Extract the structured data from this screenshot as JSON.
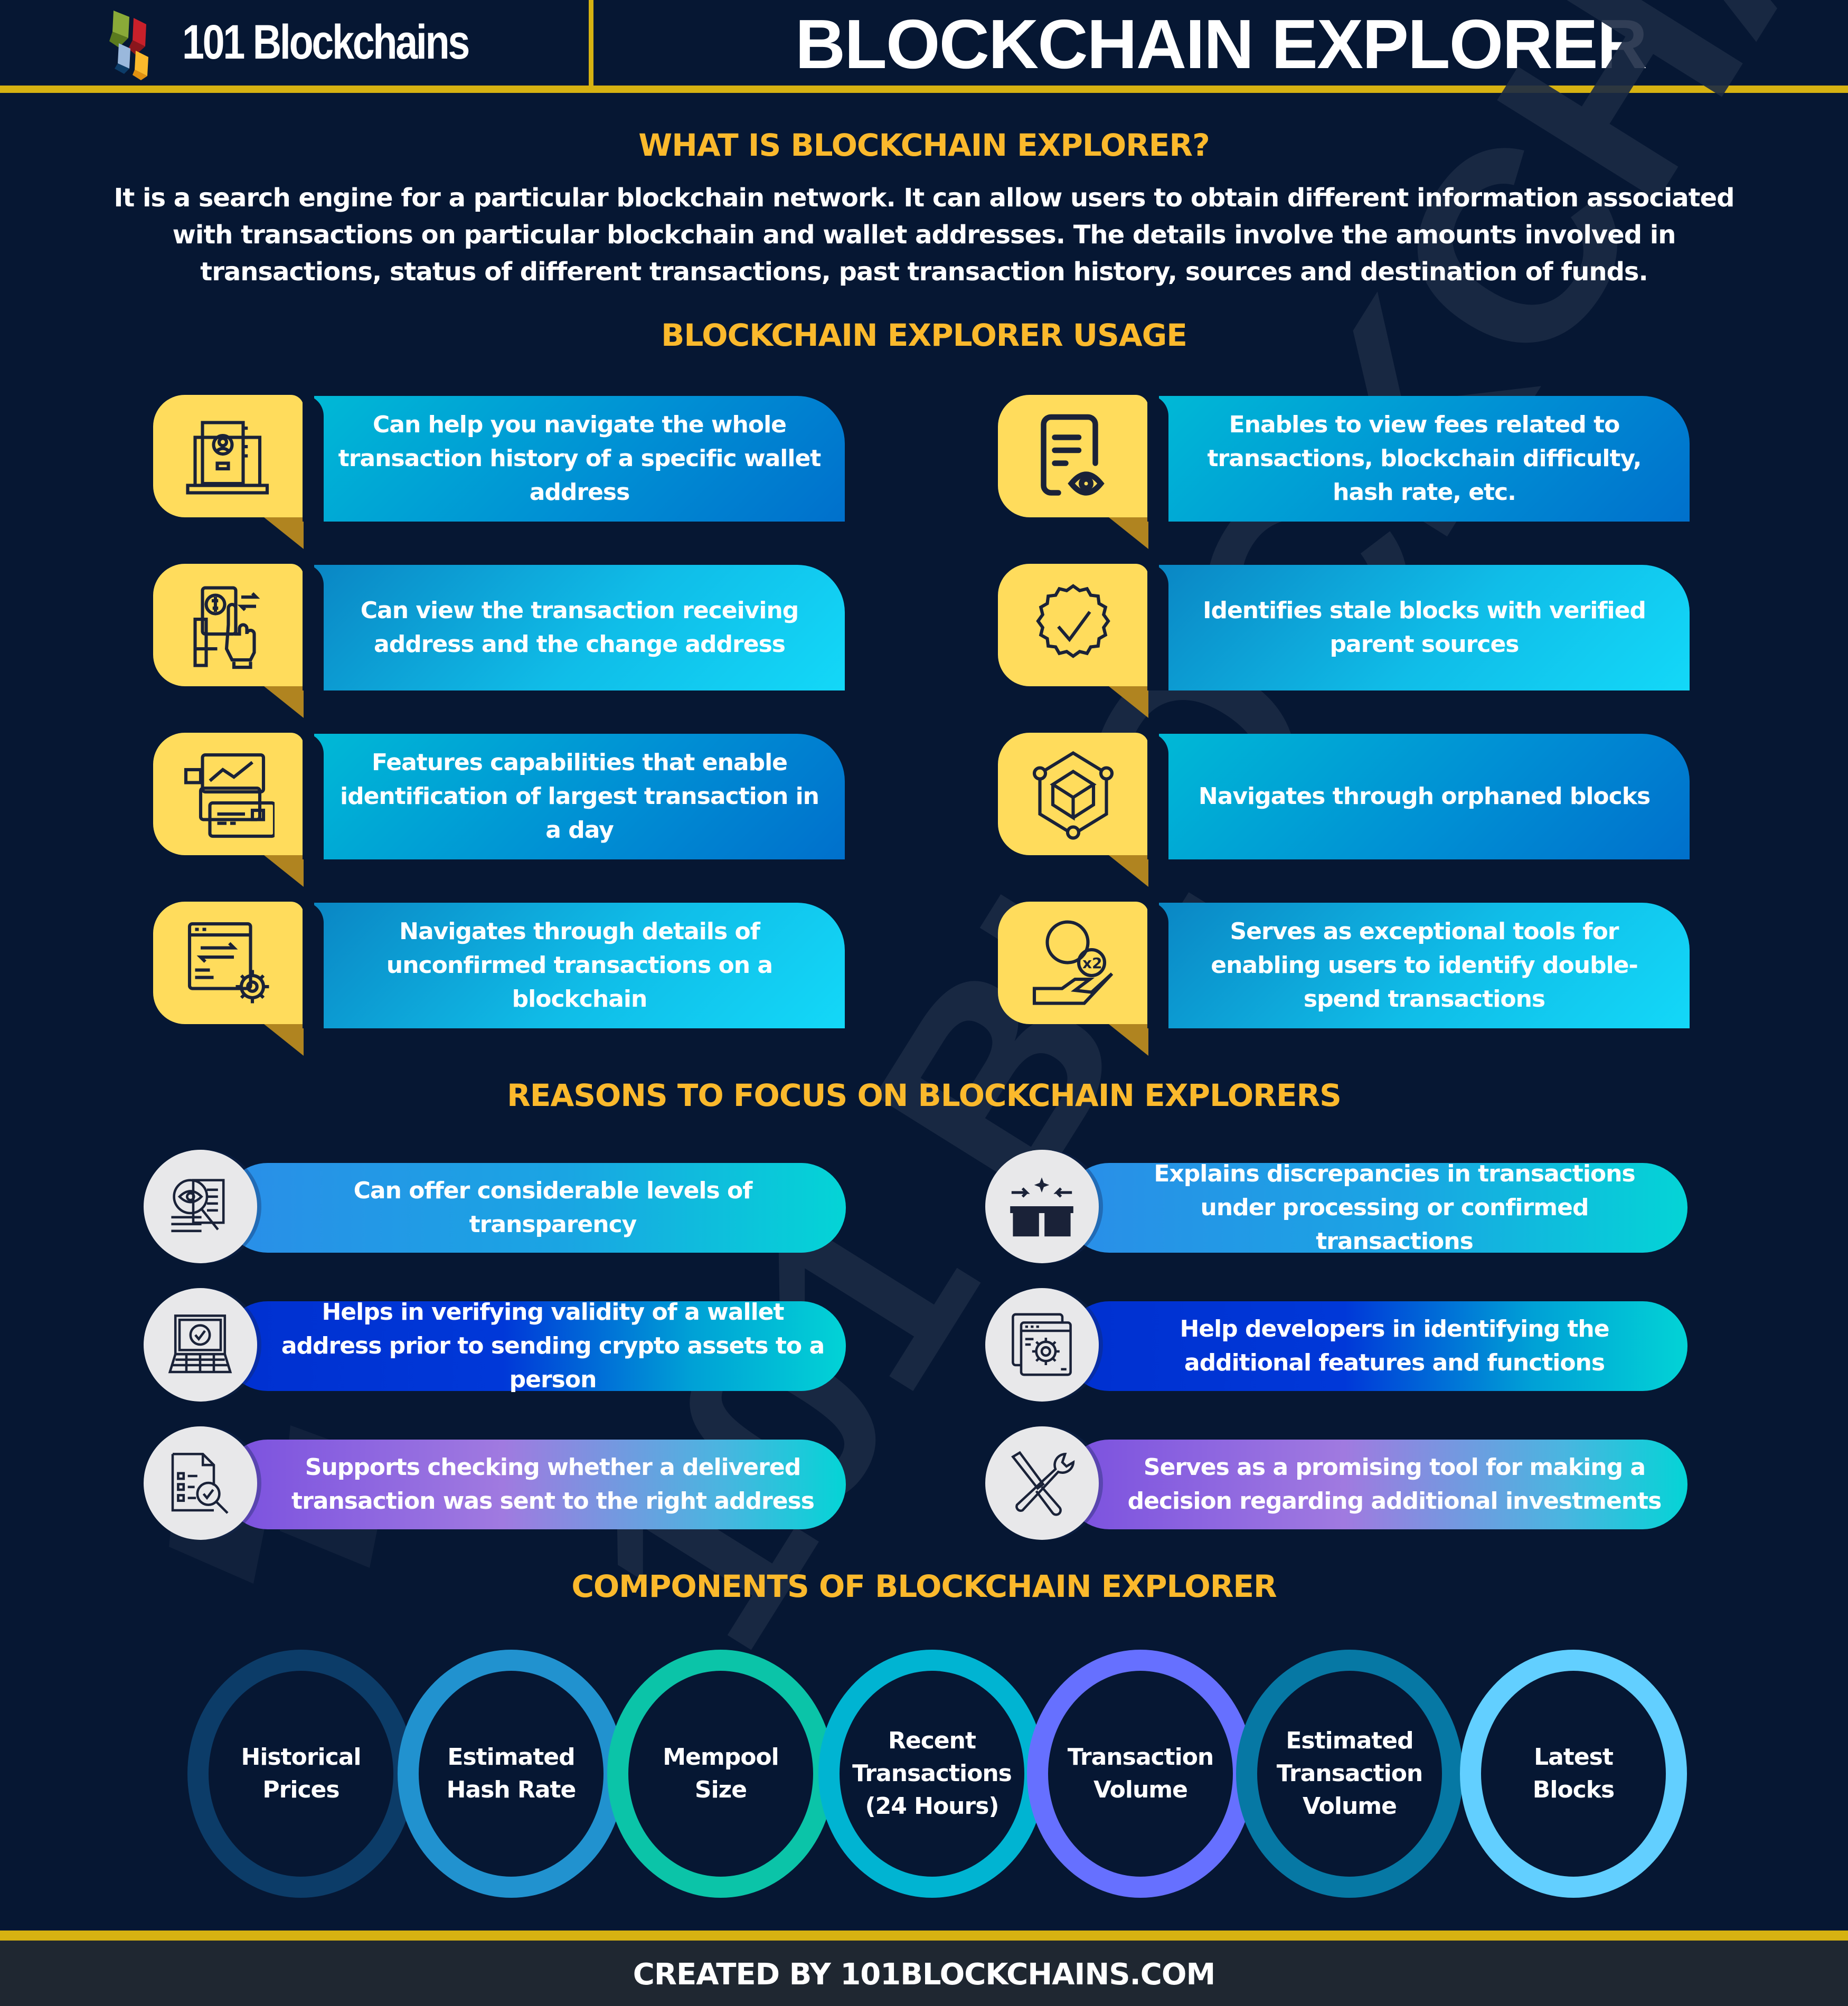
{
  "header": {
    "logo_text": "101 Blockchains",
    "title": "BLOCKCHAIN EXPLORER"
  },
  "intro": {
    "heading": "WHAT IS BLOCKCHAIN EXPLORER?",
    "text": "It is a search engine for a particular blockchain network. It can allow users to obtain different information associated with transactions on particular blockchain and wallet addresses. The details involve the amounts involved in transactions, status of different transactions, past transaction history, sources and destination of funds."
  },
  "usage": {
    "heading": "BLOCKCHAIN EXPLORER USAGE",
    "items": [
      {
        "icon": "laptop-profile-icon",
        "text": "Can help you navigate the whole transaction history of a specific wallet address"
      },
      {
        "icon": "document-eye-icon",
        "text": "Enables to view fees related to transactions, blockchain difficulty, hash rate, etc."
      },
      {
        "icon": "hand-dollar-transfer-icon",
        "text": "Can view the transaction receiving address and the change address"
      },
      {
        "icon": "verified-badge-icon",
        "text": "Identifies stale blocks with verified parent sources"
      },
      {
        "icon": "cards-chart-icon",
        "text": "Features capabilities that enable identification of largest transaction in a day"
      },
      {
        "icon": "block-network-icon",
        "text": "Navigates through orphaned blocks"
      },
      {
        "icon": "screen-gear-transfer-icon",
        "text": "Navigates through details of unconfirmed transactions on a blockchain"
      },
      {
        "icon": "hand-coins-x2-icon",
        "text": "Serves as exceptional tools for enabling users to identify double-spend transactions"
      }
    ]
  },
  "reasons": {
    "heading": "REASONS TO FOCUS ON BLOCKCHAIN EXPLORERS",
    "items": [
      {
        "icon": "magnifier-eye-document-icon",
        "text": "Can offer considerable levels of transparency"
      },
      {
        "icon": "boxes-merge-icon",
        "text": "Explains discrepancies in transactions under processing or confirmed transactions"
      },
      {
        "icon": "laptop-check-icon",
        "text": "Helps in verifying validity of a wallet address prior to sending crypto assets to a person"
      },
      {
        "icon": "browser-gear-icon",
        "text": "Help developers in identifying the additional features and functions"
      },
      {
        "icon": "checklist-magnifier-icon",
        "text": "Supports checking whether a delivered transaction was sent to the right address"
      },
      {
        "icon": "wrench-screwdriver-icon",
        "text": "Serves as a promising tool for making a decision regarding additional investments"
      }
    ]
  },
  "components": {
    "heading": "COMPONENTS OF BLOCKCHAIN EXPLORER",
    "items": [
      {
        "label": "Historical Prices",
        "color": "#0c3c68"
      },
      {
        "label": "Estimated Hash Rate",
        "color": "#2192cf"
      },
      {
        "label": "Mempool Size",
        "color": "#0bc4a8"
      },
      {
        "label": "Recent Transactions (24 Hours)",
        "color": "#00b4d2"
      },
      {
        "label": "Transaction Volume",
        "color": "#6670ff"
      },
      {
        "label": "Estimated Transaction Volume",
        "color": "#0678a4"
      },
      {
        "label": "Latest Blocks",
        "color": "#62cfff"
      }
    ]
  },
  "footer": {
    "text": "CREATED BY 101BLOCKCHAINS.COM"
  },
  "colors": {
    "background": "#061733",
    "gold": "#d6b212",
    "heading": "#fbb92c",
    "icon_tile": "#ffdc5c",
    "footer_bg": "#1f2731"
  }
}
